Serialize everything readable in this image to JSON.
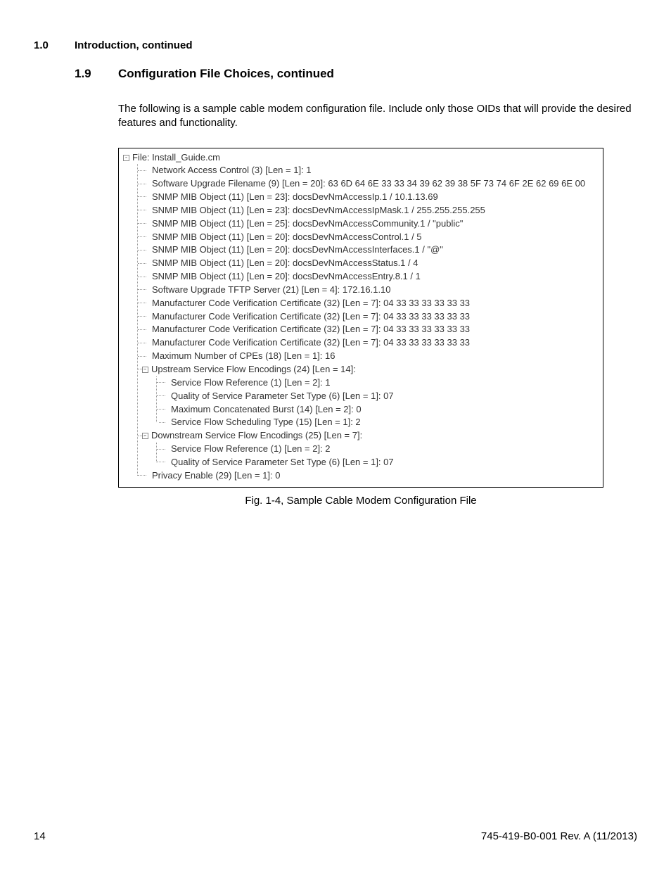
{
  "header": {
    "section_num": "1.0",
    "section_title": "Introduction, continued",
    "subsection_num": "1.9",
    "subsection_title": "Configuration File Choices, continued"
  },
  "body_paragraph": "The following is a sample cable modem configuration file. Include only those OIDs that will provide the desired features and functionality.",
  "tree": {
    "root_label": "File: Install_Guide.cm",
    "children": [
      {
        "label": "Network Access Control (3) [Len = 1]: 1"
      },
      {
        "label": "Software Upgrade Filename (9) [Len = 20]: 63 6D 64 6E 33 33 34 39 62 39 38 5F 73 74 6F 2E 62 69 6E 00"
      },
      {
        "label": "SNMP MIB Object (11) [Len = 23]: docsDevNmAccessIp.1 / 10.1.13.69"
      },
      {
        "label": "SNMP MIB Object (11) [Len = 23]: docsDevNmAccessIpMask.1 / 255.255.255.255"
      },
      {
        "label": "SNMP MIB Object (11) [Len = 25]: docsDevNmAccessCommunity.1 / \"public\""
      },
      {
        "label": "SNMP MIB Object (11) [Len = 20]: docsDevNmAccessControl.1 / 5"
      },
      {
        "label": "SNMP MIB Object (11) [Len = 20]: docsDevNmAccessInterfaces.1 / \"@\""
      },
      {
        "label": "SNMP MIB Object (11) [Len = 20]: docsDevNmAccessStatus.1 / 4"
      },
      {
        "label": "SNMP MIB Object (11) [Len = 20]: docsDevNmAccessEntry.8.1 / 1"
      },
      {
        "label": "Software Upgrade TFTP Server (21) [Len = 4]: 172.16.1.10"
      },
      {
        "label": "Manufacturer Code Verification Certificate (32) [Len = 7]: 04 33 33 33 33 33 33"
      },
      {
        "label": "Manufacturer Code Verification Certificate (32) [Len = 7]: 04 33 33 33 33 33 33"
      },
      {
        "label": "Manufacturer Code Verification Certificate (32) [Len = 7]: 04 33 33 33 33 33 33"
      },
      {
        "label": "Manufacturer Code Verification Certificate (32) [Len = 7]: 04 33 33 33 33 33 33"
      },
      {
        "label": "Maximum Number of CPEs (18) [Len = 1]: 16"
      },
      {
        "label": "Upstream Service Flow Encodings (24) [Len = 14]:",
        "expandable": true,
        "children": [
          {
            "label": "Service Flow Reference (1) [Len = 2]: 1"
          },
          {
            "label": "Quality of Service Parameter Set Type (6) [Len = 1]: 07"
          },
          {
            "label": "Maximum Concatenated Burst (14) [Len = 2]: 0"
          },
          {
            "label": "Service Flow Scheduling Type (15) [Len = 1]: 2"
          }
        ]
      },
      {
        "label": "Downstream Service Flow Encodings (25) [Len = 7]:",
        "expandable": true,
        "children": [
          {
            "label": "Service Flow Reference (1) [Len = 2]: 2"
          },
          {
            "label": "Quality of Service Parameter Set Type (6) [Len = 1]: 07"
          }
        ]
      },
      {
        "label": "Privacy Enable (29) [Len = 1]: 0"
      }
    ]
  },
  "figure_caption": "Fig. 1-4, Sample Cable Modem Configuration File",
  "footer": {
    "page_number": "14",
    "doc_id": "745-419-B0-001 Rev. A (11/2013)"
  },
  "expander_glyph": "-"
}
